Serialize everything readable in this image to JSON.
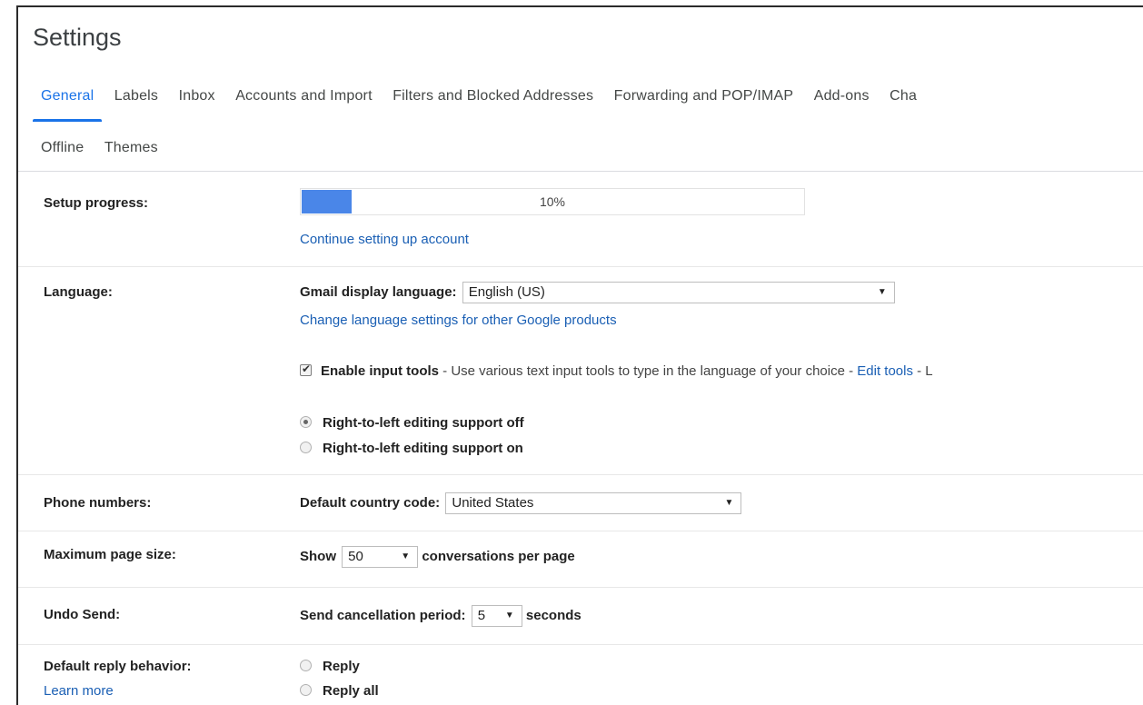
{
  "page": {
    "title": "Settings"
  },
  "tabs": {
    "row1": [
      "General",
      "Labels",
      "Inbox",
      "Accounts and Import",
      "Filters and Blocked Addresses",
      "Forwarding and POP/IMAP",
      "Add-ons",
      "Cha"
    ],
    "row2": [
      "Offline",
      "Themes"
    ],
    "active": "General"
  },
  "setup": {
    "label": "Setup progress:",
    "percent_text": "10%",
    "progress_fraction": 0.1,
    "link": "Continue setting up account"
  },
  "language": {
    "label": "Language:",
    "display_label": "Gmail display language:",
    "display_value": "English (US)",
    "other_link": "Change language settings for other Google products",
    "input_tools_bold": "Enable input tools",
    "input_tools_desc": " - Use various text input tools to type in the language of your choice - ",
    "edit_tools_link": "Edit tools",
    "trailing": " - L",
    "input_tools_checked": true,
    "rtl_off": "Right-to-left editing support off",
    "rtl_on": "Right-to-left editing support on",
    "rtl_selected": "off"
  },
  "phone": {
    "label": "Phone numbers:",
    "country_label": "Default country code:",
    "country_value": "United States"
  },
  "page_size": {
    "label": "Maximum page size:",
    "show": "Show",
    "value": "50",
    "suffix": "conversations per page"
  },
  "undo_send": {
    "label": "Undo Send:",
    "period_label": "Send cancellation period:",
    "value": "5",
    "suffix": "seconds"
  },
  "reply": {
    "label": "Default reply behavior:",
    "learn_more": "Learn more",
    "option_reply": "Reply",
    "option_reply_all": "Reply all"
  },
  "icons": {
    "dropdown": "▼",
    "check": "✔"
  },
  "colors": {
    "accent": "#1a73e8",
    "progress": "#4a86e8",
    "link": "#1a5fb4"
  }
}
